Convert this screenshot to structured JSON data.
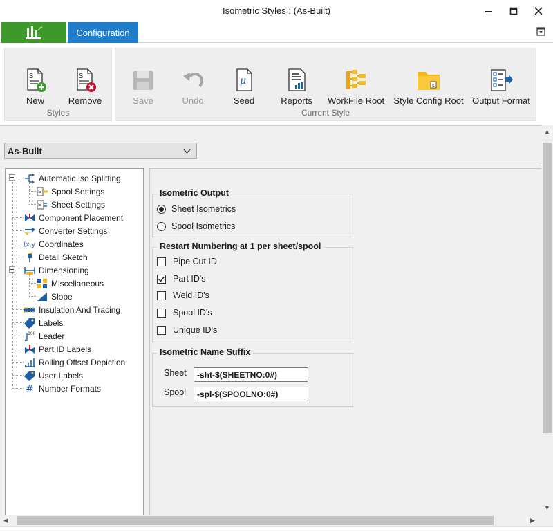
{
  "window": {
    "title": "Isometric Styles : (As-Built)"
  },
  "ribbon": {
    "tabs": [
      {
        "label": "Configuration",
        "active": true
      }
    ],
    "groups": {
      "styles": {
        "label": "Styles",
        "buttons": {
          "new": "New",
          "remove": "Remove"
        }
      },
      "current": {
        "label": "Current Style",
        "buttons": {
          "save": "Save",
          "undo": "Undo",
          "seed": "Seed",
          "reports": "Reports",
          "workfile_root": "WorkFile Root",
          "style_config_root": "Style Config Root",
          "output_format": "Output Format"
        }
      }
    }
  },
  "style_selector": {
    "value": "As-Built"
  },
  "tree": {
    "items": [
      {
        "label": "Automatic Iso Splitting",
        "icon": "split-icon"
      },
      {
        "label": "Spool Settings",
        "icon": "spool-settings-icon"
      },
      {
        "label": "Sheet Settings",
        "icon": "sheet-settings-icon"
      },
      {
        "label": "Component Placement",
        "icon": "valve-icon"
      },
      {
        "label": "Converter Settings",
        "icon": "converter-icon"
      },
      {
        "label": "Coordinates",
        "icon": "coordinates-icon"
      },
      {
        "label": "Detail Sketch",
        "icon": "pin-icon"
      },
      {
        "label": "Dimensioning",
        "icon": "dimension-icon"
      },
      {
        "label": "Miscellaneous",
        "icon": "misc-icon"
      },
      {
        "label": "Slope",
        "icon": "slope-icon"
      },
      {
        "label": "Insulation And Tracing",
        "icon": "insulation-icon"
      },
      {
        "label": "Labels",
        "icon": "tag-icon"
      },
      {
        "label": "Leader",
        "icon": "leader-icon"
      },
      {
        "label": "Part ID Labels",
        "icon": "part-id-icon"
      },
      {
        "label": "Rolling Offset Depiction",
        "icon": "rolling-offset-icon"
      },
      {
        "label": "User Labels",
        "icon": "user-tag-icon"
      },
      {
        "label": "Number Formats",
        "icon": "hash-icon"
      }
    ]
  },
  "isometric_output": {
    "title": "Isometric Output",
    "options": [
      {
        "label": "Sheet Isometrics",
        "selected": true
      },
      {
        "label": "Spool Isometrics",
        "selected": false
      }
    ]
  },
  "restart_numbering": {
    "title": "Restart Numbering at 1 per sheet/spool",
    "options": [
      {
        "label": "Pipe Cut ID",
        "checked": false
      },
      {
        "label": "Part ID's",
        "checked": true
      },
      {
        "label": "Weld ID's",
        "checked": false
      },
      {
        "label": "Spool ID's",
        "checked": false
      },
      {
        "label": "Unique ID's",
        "checked": false
      }
    ]
  },
  "name_suffix": {
    "title": "Isometric Name Suffix",
    "sheet_label": "Sheet",
    "sheet_value": "-sht-$(SHEETNO:0#)",
    "spool_label": "Spool",
    "spool_value": "-spl-$(SPOOLNO:0#)"
  },
  "colors": {
    "app_tab": "#3d9a2a",
    "active_tab": "#1f7dc9",
    "panel": "#f0f0f0"
  }
}
